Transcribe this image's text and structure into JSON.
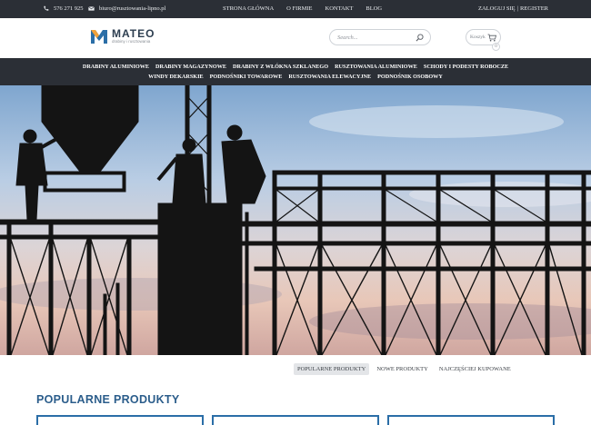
{
  "topbar": {
    "phone": "576 271 925",
    "email": "biuro@rusztowania-lipno.pl",
    "nav": [
      "STRONA GŁÓWNA",
      "O FIRMIE",
      "KONTAKT",
      "BLOG"
    ],
    "login": "ZALOGUJ SIĘ",
    "separator": "|",
    "register": "REGISTER"
  },
  "header": {
    "brand": "MATEO",
    "tagline": "drabiny i rusztowania",
    "search_placeholder": "Search...",
    "cart_label": "Koszyk",
    "cart_count": "0"
  },
  "mainnav": {
    "row1": [
      "DRABINY ALUMINIOWE",
      "DRABINY MAGAZYNOWE",
      "DRABINY Z WŁÓKNA SZKLANEGO",
      "RUSZTOWANIA ALUMINIOWE",
      "SCHODY I PODESTY ROBOCZE"
    ],
    "row2": [
      "WINDY DEKARSKIE",
      "PODNOŚNIKI TOWAROWE",
      "RUSZTOWANIA ELEWACYJNE",
      "PODNOŚNIK OSOBOWY"
    ]
  },
  "product_tabs": [
    "POPULARNE PRODUKTY",
    "NOWE PRODUKTY",
    "NAJCZĘŚCIEJ KUPOWANE"
  ],
  "section": {
    "title": "POPULARNE PRODUKTY"
  },
  "colors": {
    "dark": "#2b2f36",
    "accent": "#2b6ea7",
    "title": "#2b5d8b"
  },
  "icons": {
    "phone": "phone-icon",
    "mail": "mail-icon",
    "search": "search-icon",
    "cart": "cart-icon"
  }
}
